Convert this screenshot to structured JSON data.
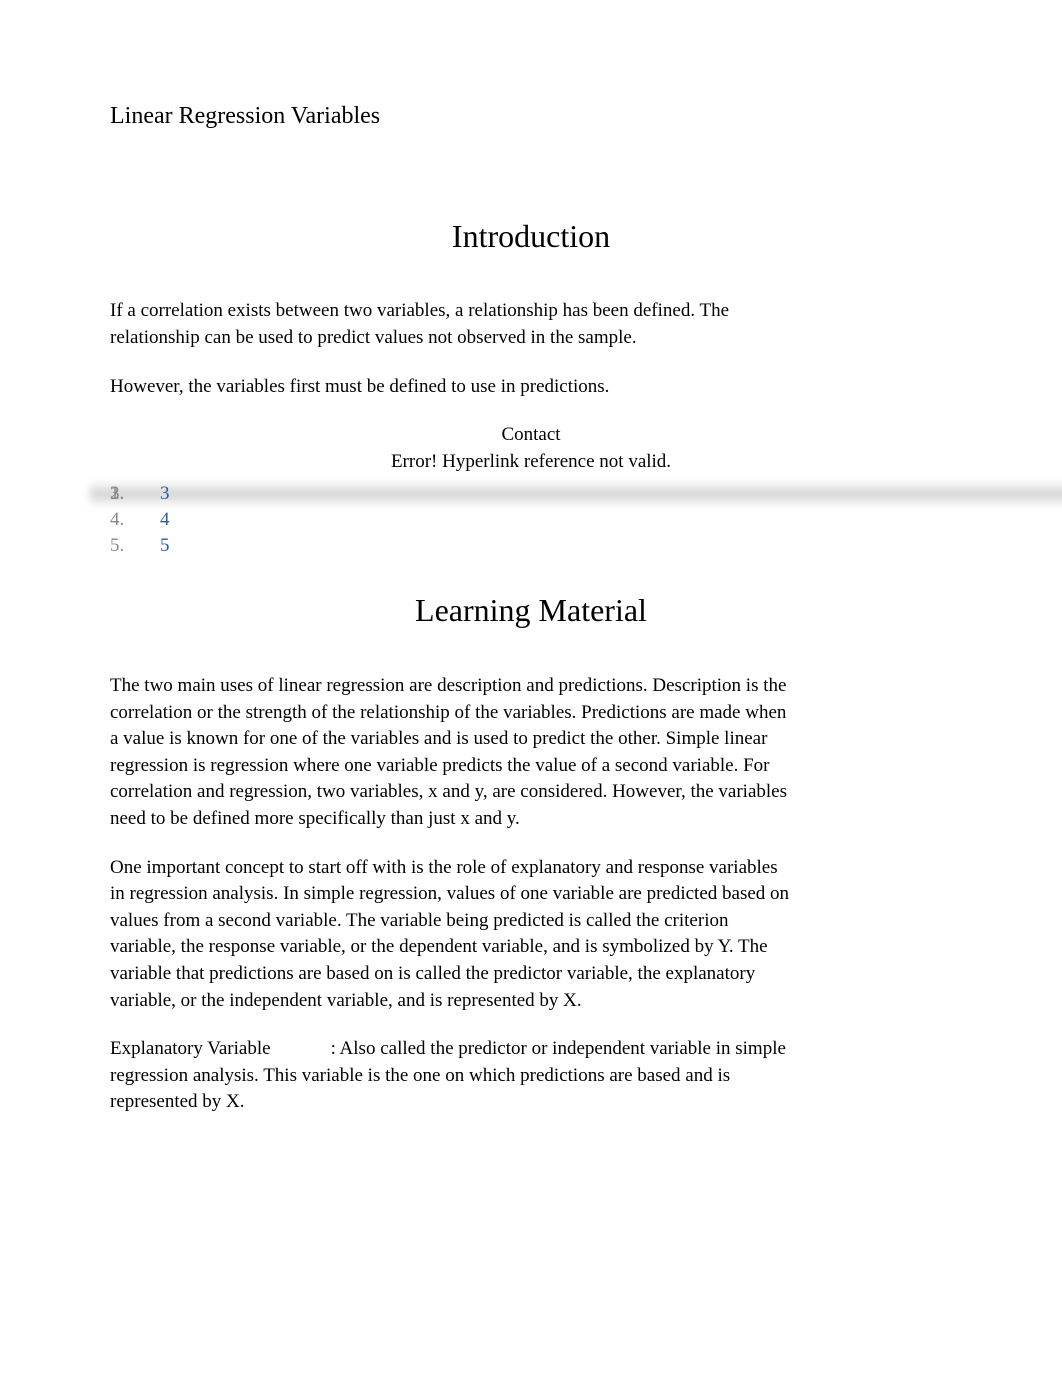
{
  "title": "Linear Regression Variables",
  "intro": {
    "heading": "Introduction",
    "para1": "If a correlation exists between two variables, a relationship has been defined. The relationship can be used to predict values not observed in the sample.",
    "para2": "However, the variables first must be defined to use in predictions."
  },
  "contact": {
    "label": "Contact",
    "error": "Error! Hyperlink reference not valid."
  },
  "list": {
    "items": [
      {
        "text": "",
        "link": false
      },
      {
        "text": "",
        "link": false,
        "blur": true
      },
      {
        "text": "3",
        "link": true
      },
      {
        "text": "4",
        "link": true
      },
      {
        "text": "5",
        "link": true
      }
    ]
  },
  "learning": {
    "heading": "Learning Material",
    "para1": "The two main uses of linear regression are description and predictions. Description is the correlation or the strength of the relationship of the variables. Predictions are made when a value is known for one of the variables and is used to predict the other. Simple linear regression is regression where one variable predicts the value of a second variable. For correlation and regression, two variables, x and y, are considered. However, the variables need to be defined more specifically than just x and y.",
    "para2": "One important concept to start off with is the role of explanatory and response variables in regression analysis. In simple regression, values of one variable are predicted based on values from a second variable. The variable being predicted is called the criterion variable, the response variable, or the dependent variable, and is symbolized by Y. The variable that predictions are based on is called the predictor variable, the explanatory variable, or the independent variable, and is represented by X.",
    "term_label": "Explanatory Variable",
    "term_def": ": Also called the predictor or independent variable in simple regression analysis. This variable is the one on which predictions are based and is represented by X."
  }
}
